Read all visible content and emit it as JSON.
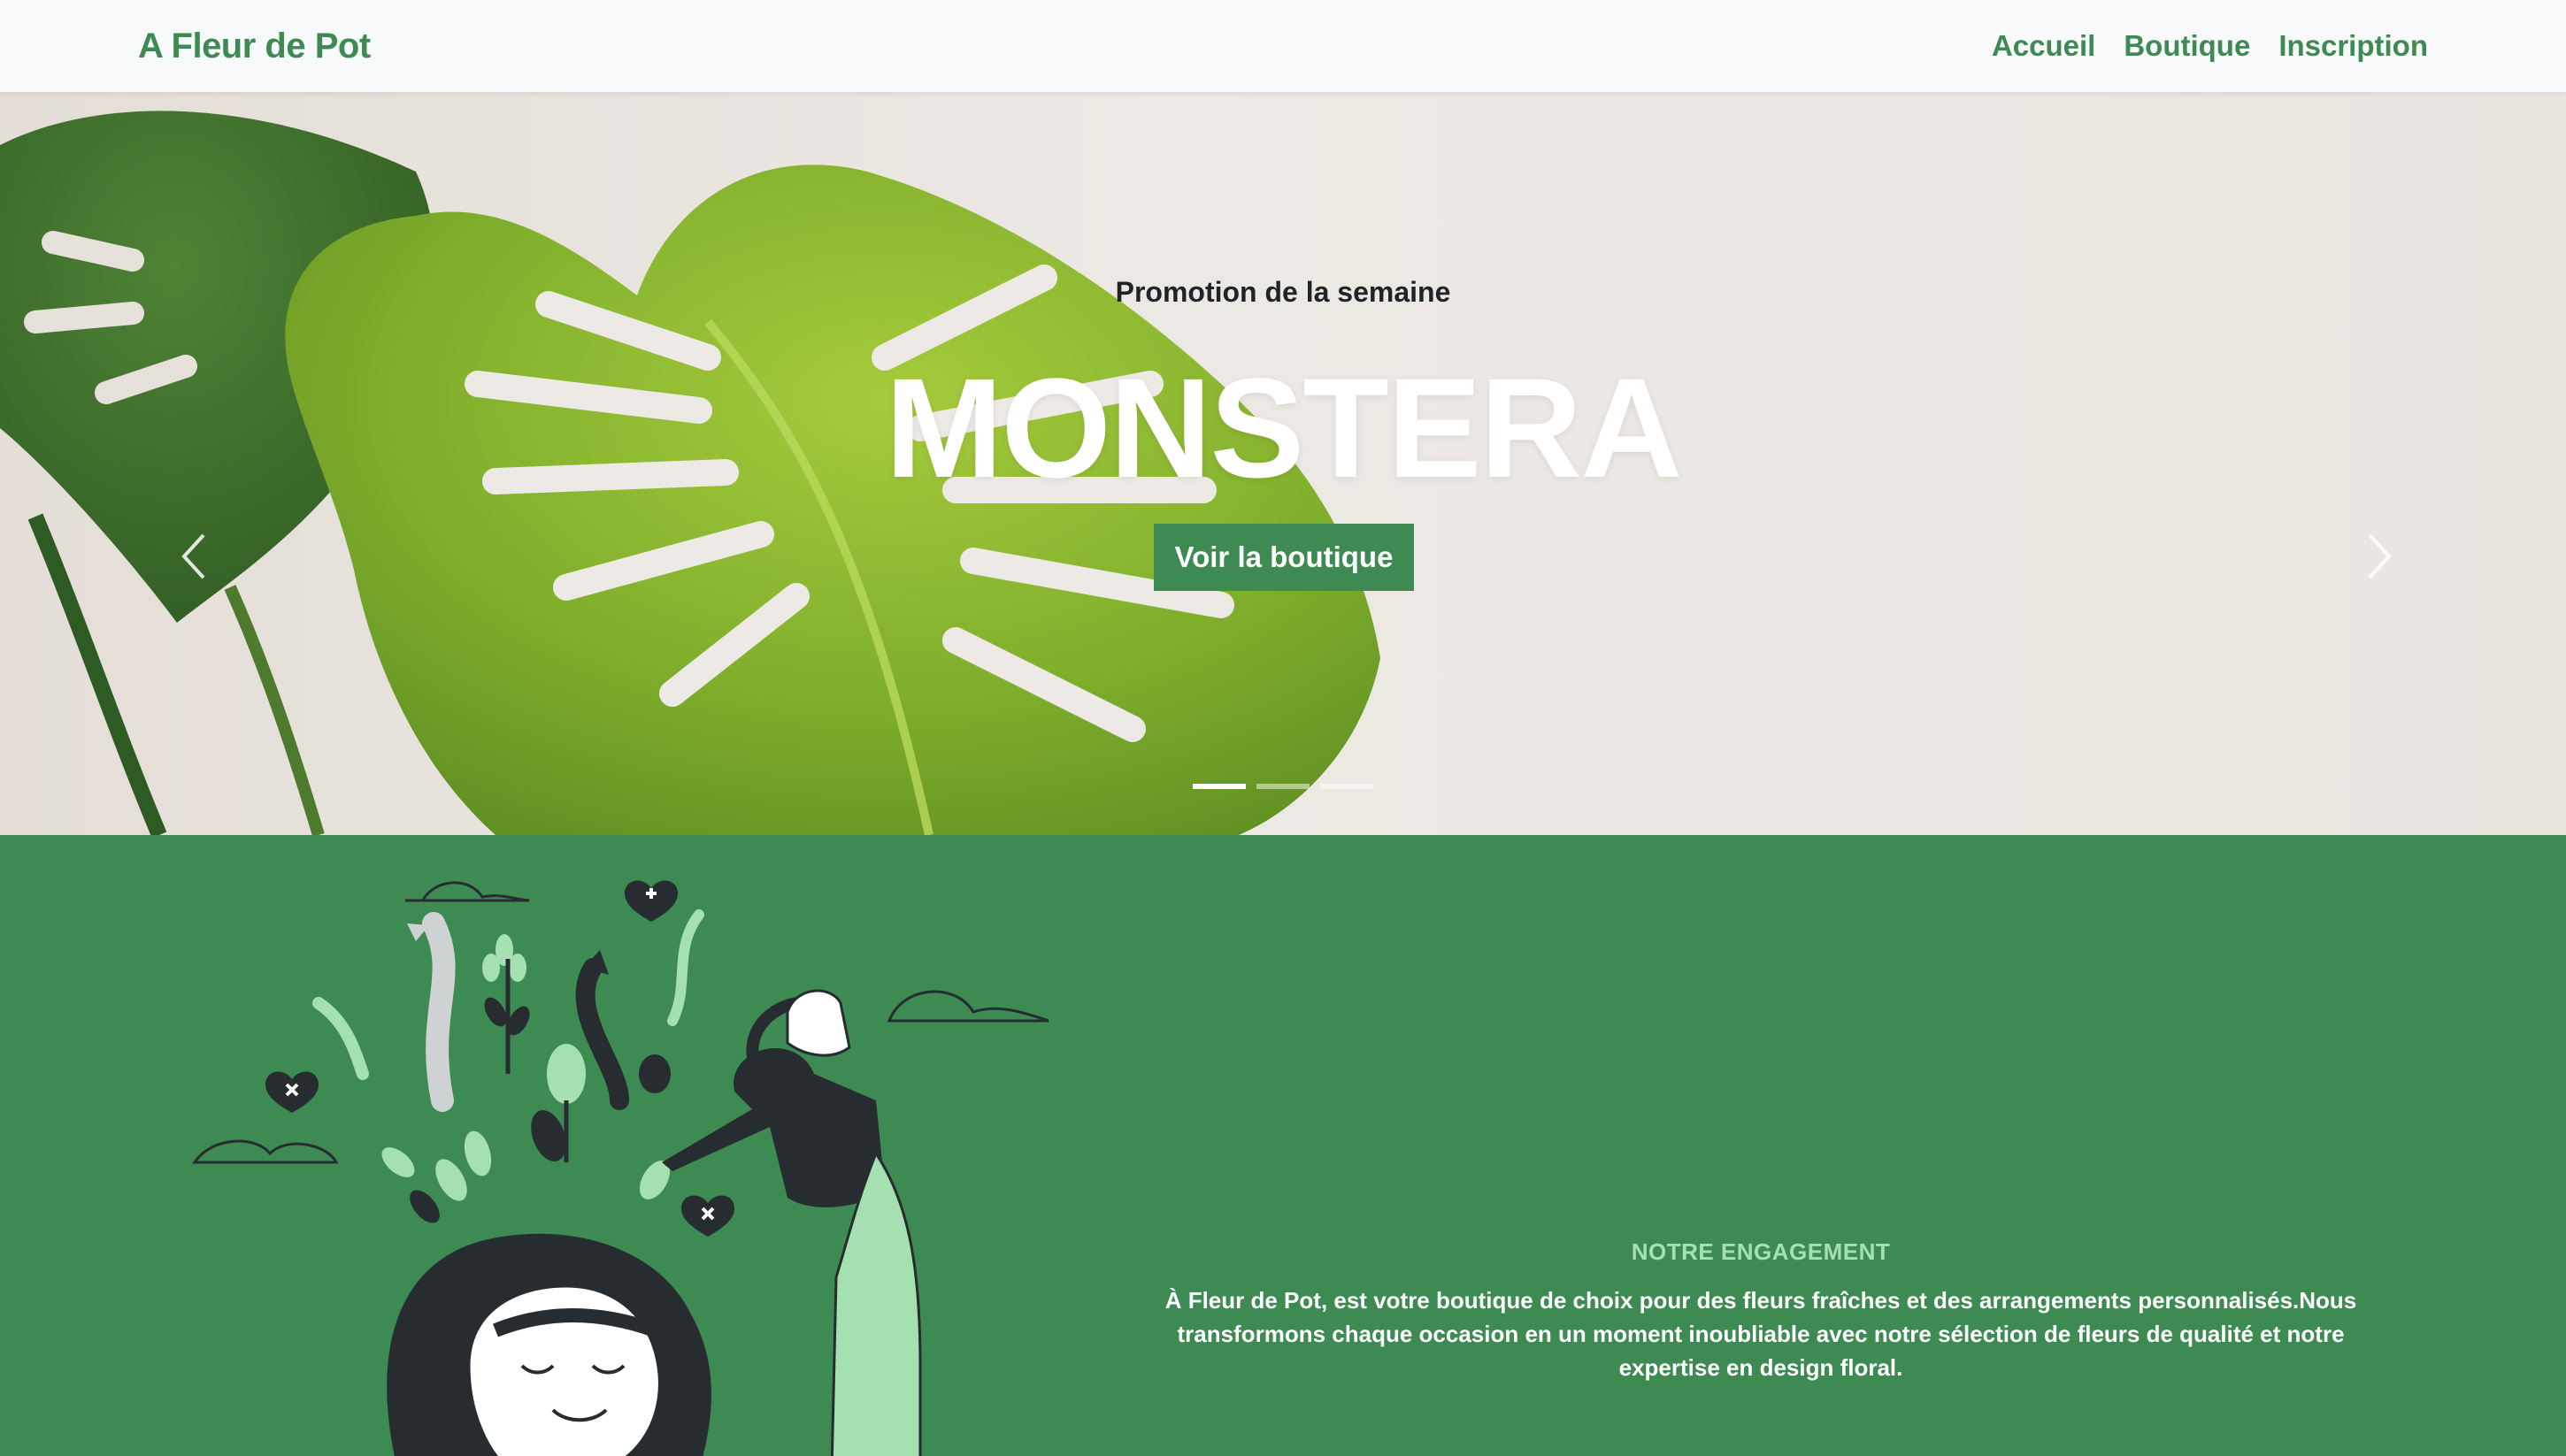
{
  "navbar": {
    "brand": "A Fleur de Pot",
    "links": [
      {
        "label": "Accueil"
      },
      {
        "label": "Boutique"
      },
      {
        "label": "Inscription"
      }
    ]
  },
  "hero": {
    "promo_label": "Promotion de la semaine",
    "title": "MONSTERA",
    "cta_label": "Voir la boutique",
    "slides_count": 3,
    "active_slide": 1
  },
  "engagement": {
    "kicker": "NOTRE ENGAGEMENT",
    "body": "À Fleur de Pot, est votre boutique de choix pour des fleurs fraîches et des arrangements personnalisés.Nous transformons chaque occasion en un moment inoubliable avec notre sélection de fleurs de qualité et notre expertise en design floral."
  },
  "colors": {
    "brand_green": "#3d8a52",
    "navbar_bg": "#f8f9fa",
    "kicker_green": "#a5e1b0",
    "illustration_dark": "#262c30",
    "illustration_light_green": "#a5e1b0"
  },
  "icons": {
    "prev": "chevron-left-icon",
    "next": "chevron-right-icon"
  }
}
